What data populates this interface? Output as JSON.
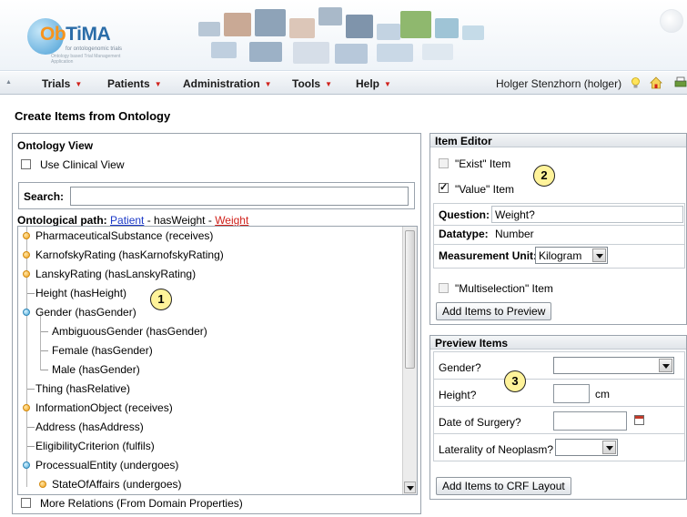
{
  "app": {
    "logo": {
      "text_ob": "Ob",
      "text_tima": "TiMA",
      "subtitle": "for ontologenomic trials",
      "tagline": "Ontology based Trial Management Application"
    },
    "colors": {
      "accent": "#2a6ca8",
      "link": "#1a38c7",
      "link_active": "#d0211b",
      "menu_arrow": "#d0211b",
      "callout": "#fff39a"
    }
  },
  "menu": {
    "items": [
      {
        "label": "Trials"
      },
      {
        "label": "Patients"
      },
      {
        "label": "Administration"
      },
      {
        "label": "Tools"
      },
      {
        "label": "Help"
      }
    ],
    "user": "Holger Stenzhorn (holger)",
    "icons": [
      "lightbulb-icon",
      "home-icon",
      "print-icon"
    ]
  },
  "page": {
    "title": "Create Items from Ontology"
  },
  "ontology_view": {
    "title": "Ontology View",
    "use_clinical_view": {
      "label": "Use Clinical View",
      "checked": false
    },
    "search": {
      "label": "Search:",
      "value": ""
    },
    "path": {
      "label": "Ontological path:",
      "root": "Patient",
      "relation": " - hasWeight - ",
      "target": "Weight"
    },
    "tree": [
      {
        "label": "PharmaceuticalSubstance (receives)",
        "marker": "orange",
        "level": 0
      },
      {
        "label": "KarnofskyRating (hasKarnofskyRating)",
        "marker": "orange",
        "level": 0
      },
      {
        "label": "LanskyRating (hasLanskyRating)",
        "marker": "orange",
        "level": 0
      },
      {
        "label": "Height (hasHeight)",
        "marker": "line",
        "level": 0
      },
      {
        "label": "Gender (hasGender)",
        "marker": "blue",
        "level": 0
      },
      {
        "label": "AmbiguousGender (hasGender)",
        "marker": "line",
        "level": 1
      },
      {
        "label": "Female (hasGender)",
        "marker": "line",
        "level": 1
      },
      {
        "label": "Male (hasGender)",
        "marker": "line",
        "level": 1
      },
      {
        "label": "Thing (hasRelative)",
        "marker": "line",
        "level": 0
      },
      {
        "label": "InformationObject (receives)",
        "marker": "orange",
        "level": 0
      },
      {
        "label": "Address (hasAddress)",
        "marker": "line",
        "level": 0
      },
      {
        "label": "EligibilityCriterion (fulfils)",
        "marker": "line",
        "level": 0
      },
      {
        "label": "ProcessualEntity (undergoes)",
        "marker": "blue",
        "level": 0
      },
      {
        "label": "StateOfAffairs (undergoes)",
        "marker": "orange",
        "level": 1
      }
    ],
    "more_relations": {
      "label": "More Relations (From Domain Properties)",
      "checked": false
    }
  },
  "item_editor": {
    "title": "Item Editor",
    "exist_item": {
      "label": "\"Exist\" Item",
      "checked": false,
      "disabled": true
    },
    "value_item": {
      "label": "\"Value\" Item",
      "checked": true
    },
    "question": {
      "label": "Question:",
      "value": "Weight?"
    },
    "datatype": {
      "label": "Datatype:",
      "value": "Number"
    },
    "measurement_unit": {
      "label": "Measurement Unit:",
      "value": "Kilogram"
    },
    "multiselection_item": {
      "label": "\"Multiselection\" Item",
      "checked": false,
      "disabled": true
    },
    "add_button": "Add Items to Preview"
  },
  "preview": {
    "title": "Preview Items",
    "rows": [
      {
        "label": "Gender?",
        "type": "select",
        "value": ""
      },
      {
        "label": "Height?",
        "type": "text",
        "value": "",
        "unit": "cm"
      },
      {
        "label": "Date of Surgery?",
        "type": "date",
        "value": ""
      },
      {
        "label": "Laterality of Neoplasm?",
        "type": "select",
        "value": ""
      }
    ],
    "add_button": "Add Items to CRF Layout"
  },
  "callouts": [
    "1",
    "2",
    "3"
  ]
}
